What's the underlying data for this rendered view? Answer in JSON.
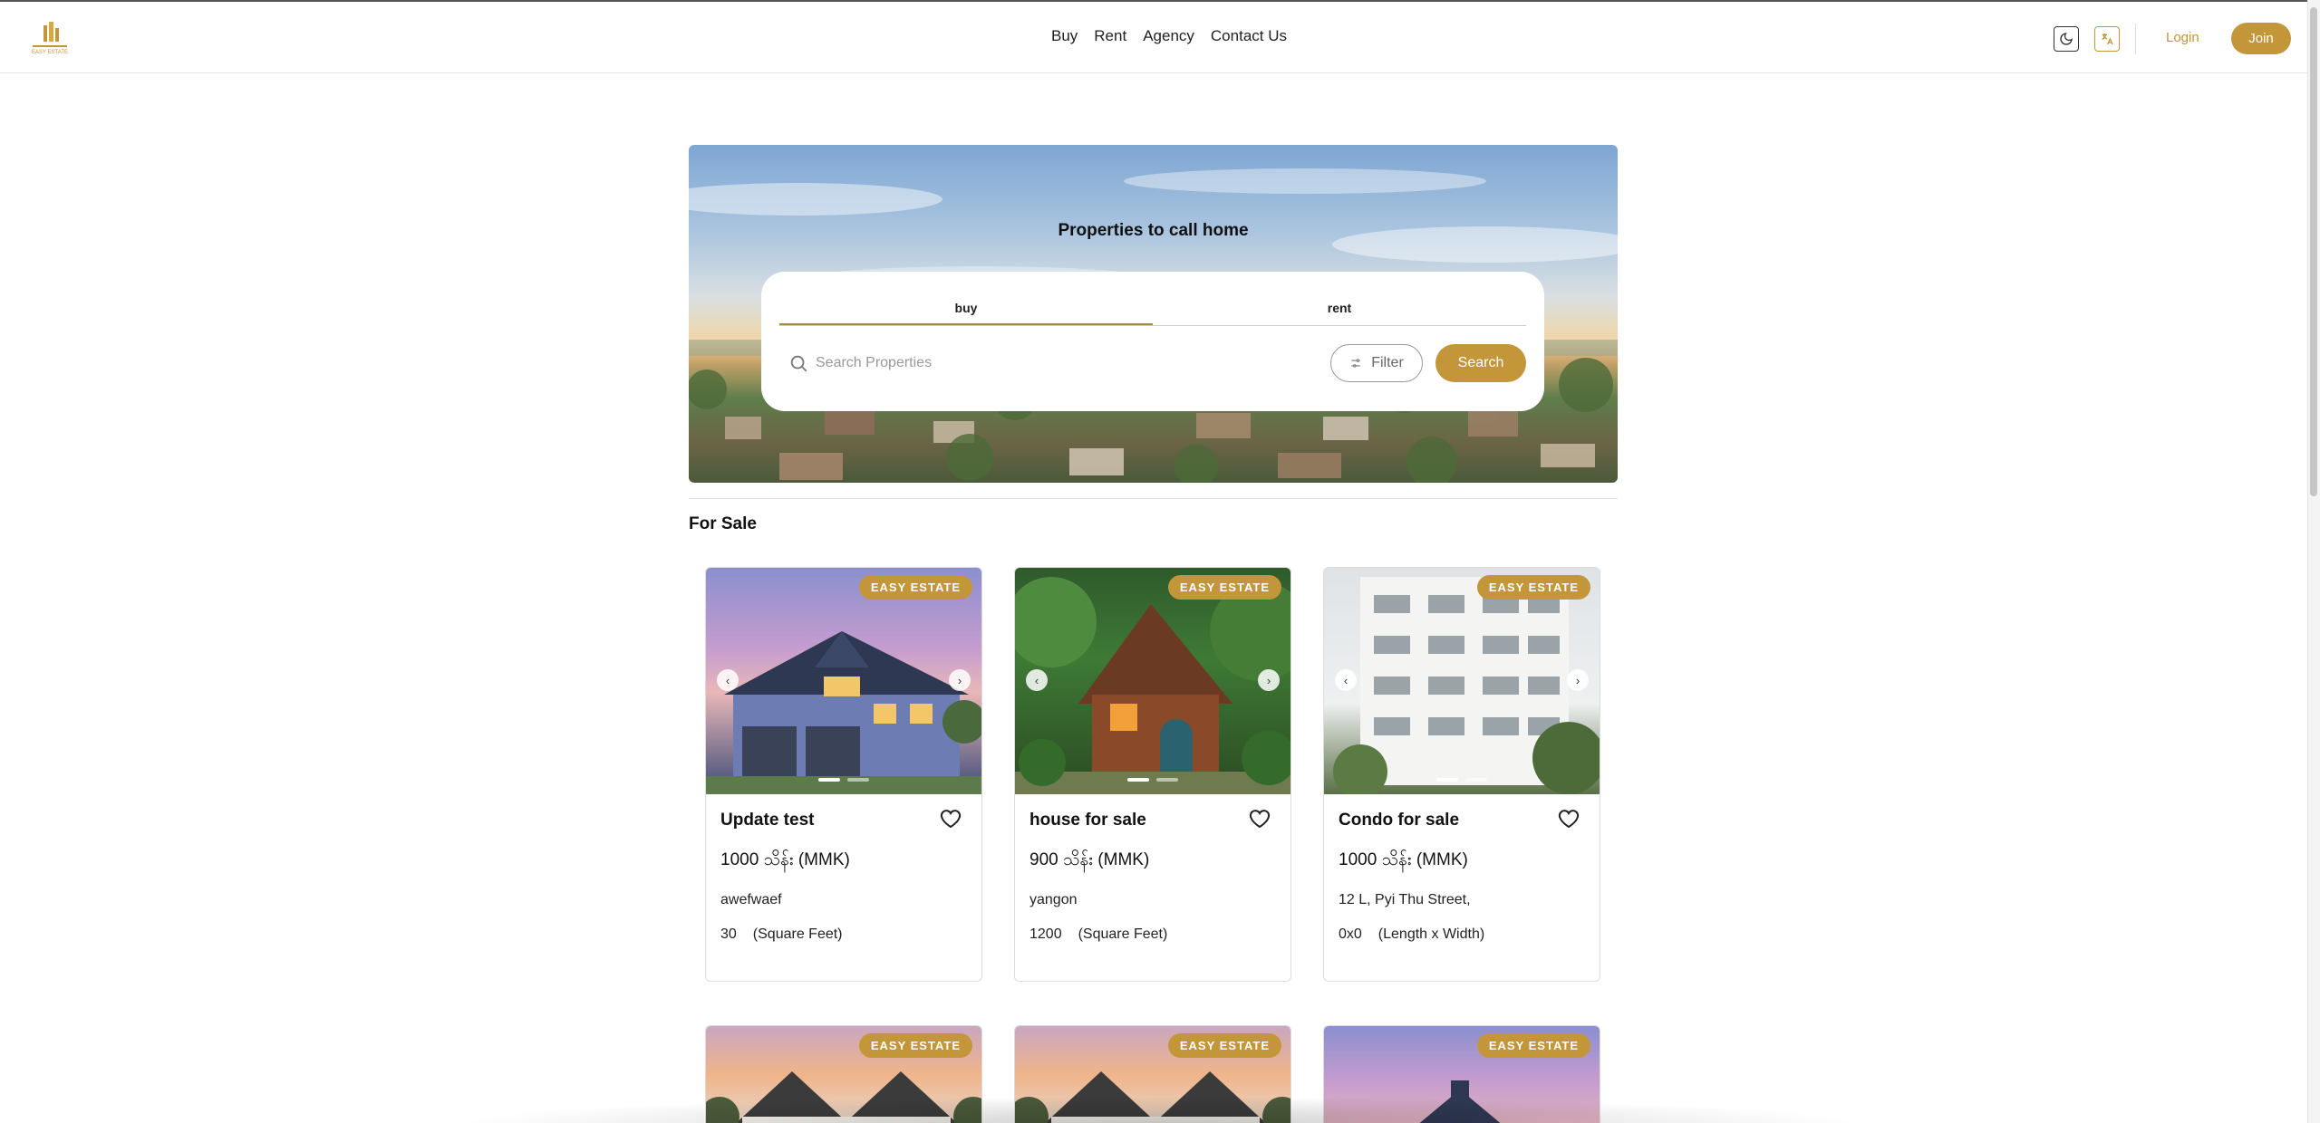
{
  "brand": {
    "logo_text": "EASY ESTATE",
    "accent": "#c4963a"
  },
  "nav": {
    "links": [
      "Buy",
      "Rent",
      "Agency",
      "Contact Us"
    ],
    "login": "Login",
    "join": "Join"
  },
  "hero": {
    "title": "Properties to call home",
    "tabs": [
      "buy",
      "rent"
    ],
    "active_tab": "buy",
    "search_placeholder": "Search Properties",
    "filter_label": "Filter",
    "search_label": "Search"
  },
  "section": {
    "title": "For Sale"
  },
  "cards": [
    {
      "badge": "EASY ESTATE",
      "title": "Update test",
      "price": "1000 သိန်း (MMK)",
      "address": "awefwaef",
      "size": "30",
      "unit": "(Square Feet)",
      "image": "blue-house-dusk"
    },
    {
      "badge": "EASY ESTATE",
      "title": "house for sale",
      "price": "900 သိန်း (MMK)",
      "address": "yangon",
      "size": "1200",
      "unit": "(Square Feet)",
      "image": "forest-cabin"
    },
    {
      "badge": "EASY ESTATE",
      "title": "Condo for sale",
      "price": "1000 သိန်း (MMK)",
      "address": "12 L, Pyi Thu Street,",
      "size": "0x0",
      "unit": "(Length x Width)",
      "image": "white-condo-building"
    }
  ],
  "cards_row2": [
    {
      "badge": "EASY ESTATE",
      "image": "white-house-sunset"
    },
    {
      "badge": "EASY ESTATE",
      "image": "white-house-sunset"
    },
    {
      "badge": "EASY ESTATE",
      "image": "blue-house-dusk"
    }
  ]
}
